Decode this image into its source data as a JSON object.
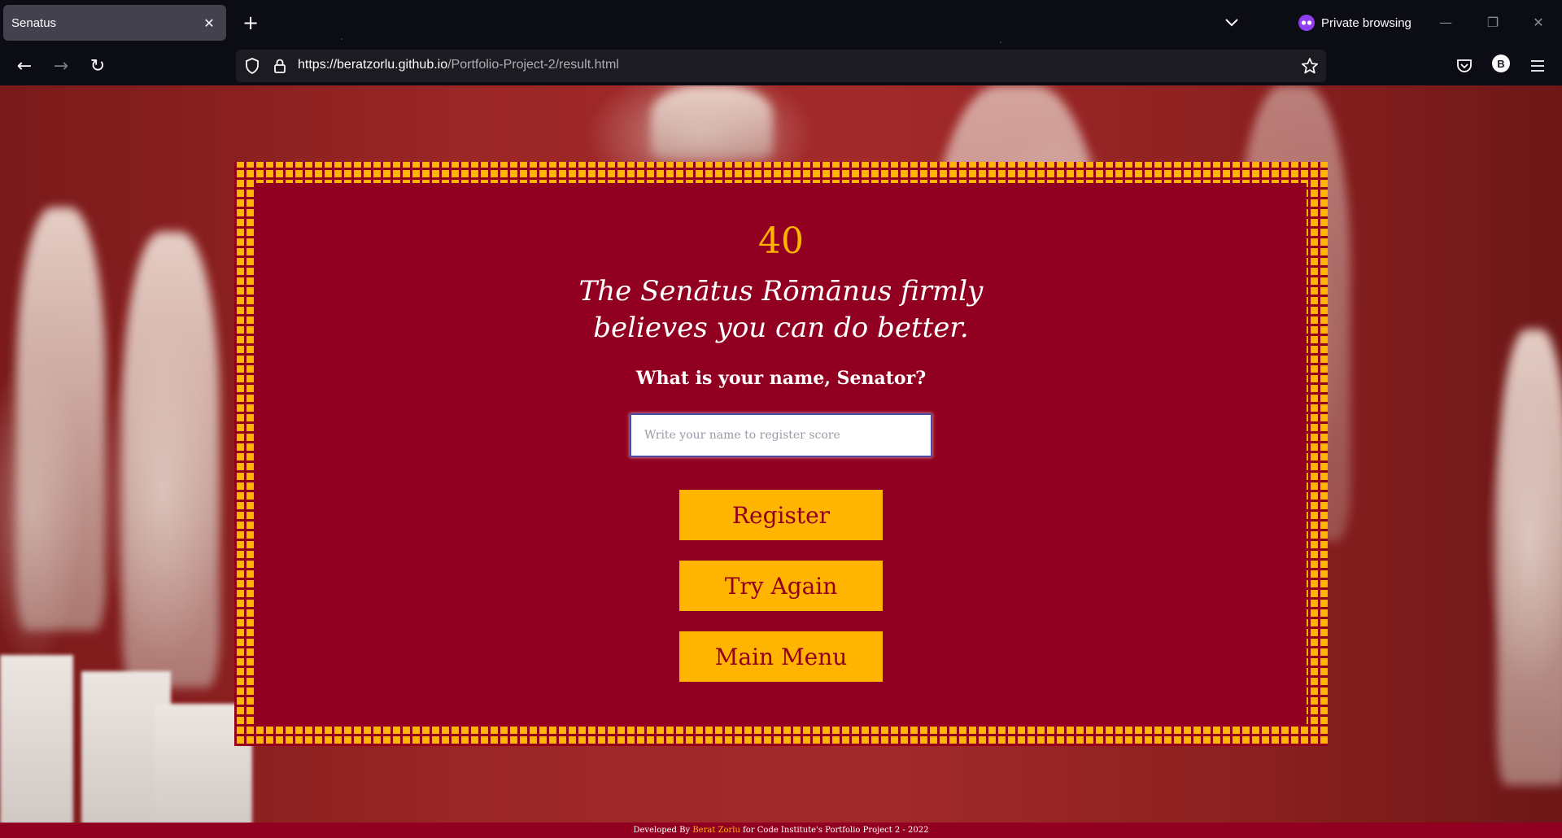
{
  "browser": {
    "tab_title": "Senatus",
    "tab_close": "✕",
    "new_tab": "+",
    "private_label": "Private browsing",
    "url_host": "https://beratzorlu.github.io",
    "url_path": "/Portfolio-Project-2/result.html",
    "account_initial": "B",
    "win_minimize": "—",
    "win_restore": "❐",
    "win_close": "✕",
    "back": "←",
    "forward": "→",
    "reload": "↻"
  },
  "page": {
    "score": "40",
    "message": "The Senātus Rōmānus firmly believes you can do better.",
    "question": "What is your name, Senator?",
    "name_placeholder": "Write your name to register score",
    "register_label": "Register",
    "try_again_label": "Try Again",
    "main_menu_label": "Main Menu"
  },
  "footer": {
    "prefix": "Developed By ",
    "author": "Berat Zorlu",
    "suffix": " for Code Institute's Portfolio Project 2 - 2022"
  },
  "colors": {
    "crimson": "#920021",
    "gold": "#ffb400",
    "chrome_tab": "#42414d",
    "chrome_bg": "#0b0c14"
  },
  "icons": [
    "close-icon",
    "plus-icon",
    "chevron-down-icon",
    "private-mask-icon",
    "back-arrow-icon",
    "forward-arrow-icon",
    "reload-icon",
    "shield-icon",
    "lock-icon",
    "star-icon",
    "pocket-icon",
    "menu-icon"
  ]
}
